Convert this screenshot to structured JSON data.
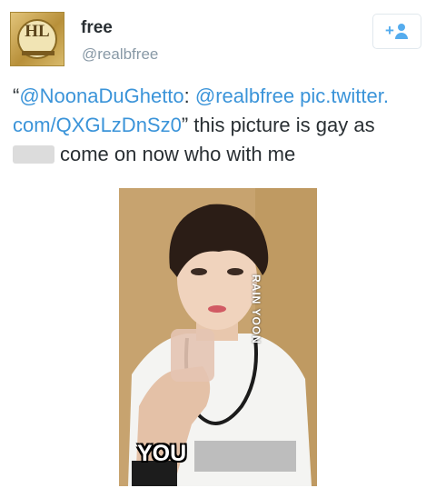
{
  "user": {
    "name": "free",
    "handle": "@realbfree",
    "avatar_monogram": "HL"
  },
  "tweet": {
    "quote_open": "“",
    "mention1": "@NoonaDuGhetto",
    "colon": ": ",
    "mention2": "@realbfree",
    "link_line1": " pic.twitter.",
    "link_line2": "com/QXGLzDnSz0",
    "rest": "” this picture is gay as ",
    "after_blur": "come on now who with me"
  },
  "image": {
    "watermark": "RAIN YOON",
    "caption": "YOU"
  },
  "icons": {
    "follow": "follow-user-icon"
  },
  "colors": {
    "link": "#3b94d9",
    "text": "#292f33",
    "muted": "#8899a6",
    "follow_icon": "#55acee"
  }
}
